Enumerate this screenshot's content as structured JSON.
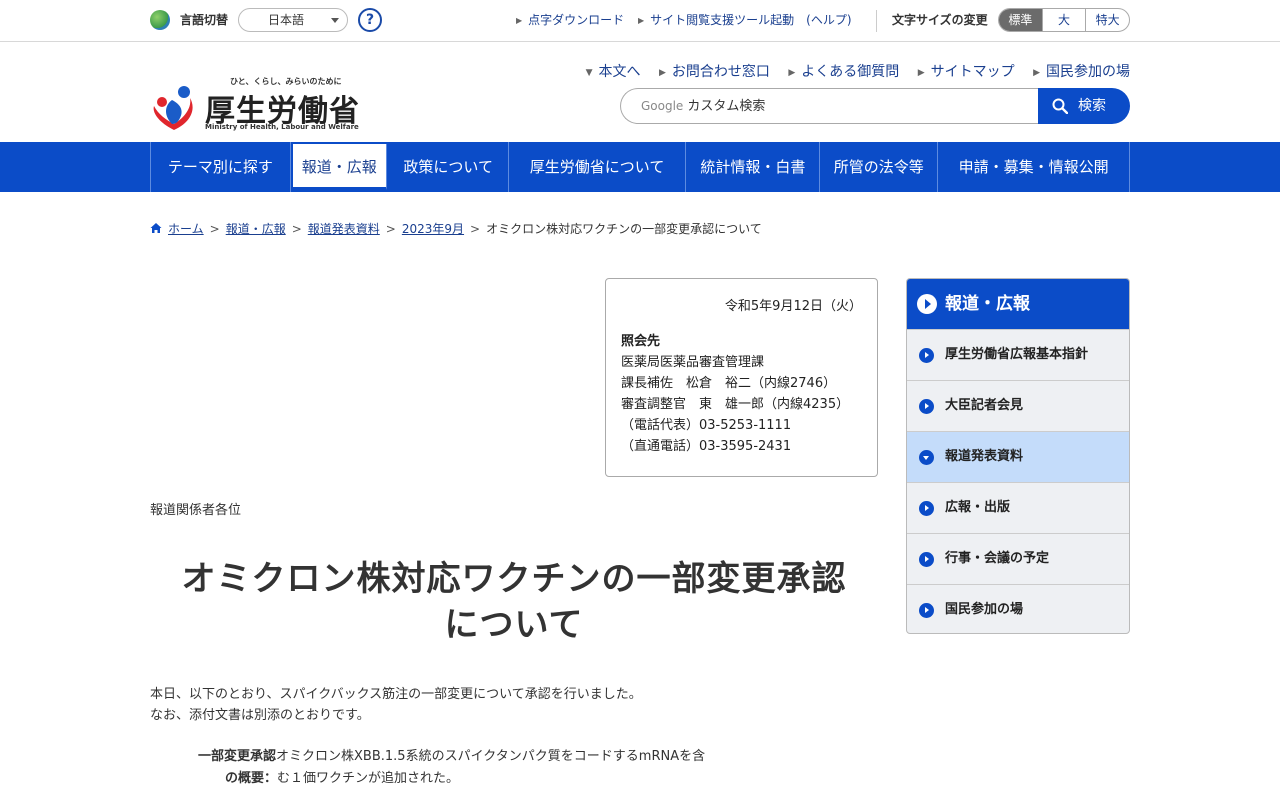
{
  "util": {
    "lang_label": "言語切替",
    "lang_value": "日本語",
    "help": "?",
    "links": [
      "点字ダウンロード",
      "サイト閲覧支援ツール起動　(ヘルプ)"
    ],
    "fontsize_label": "文字サイズの変更",
    "fontsize_options": [
      "標準",
      "大",
      "特大"
    ]
  },
  "logo": {
    "tagline": "ひと、くらし、みらいのために",
    "title": "厚生労働省",
    "english": "Ministry of Health, Labour and Welfare"
  },
  "header_links": [
    "本文へ",
    "お問合わせ窓口",
    "よくある御質問",
    "サイトマップ",
    "国民参加の場"
  ],
  "search": {
    "brand": "Google",
    "placeholder": "カスタム検索",
    "button": "検索"
  },
  "gnav": [
    "テーマ別に探す",
    "報道・広報",
    "政策について",
    "厚生労働省について",
    "統計情報・白書",
    "所管の法令等",
    "申請・募集・情報公開"
  ],
  "breadcrumb": [
    "ホーム",
    "報道・広報",
    "報道発表資料",
    "2023年9月",
    "オミクロン株対応ワクチンの一部変更承認について"
  ],
  "contact": {
    "date": "令和5年9月12日（火）",
    "heading": "照会先",
    "lines": [
      "医薬局医薬品審査管理課",
      "課長補佐　松倉　裕二（内線2746）",
      "審査調整官　東　雄一郎（内線4235）",
      "（電話代表）03-5253-1111",
      "（直通電話）03-3595-2431"
    ]
  },
  "addressee": "報道関係者各位",
  "title_line1": "オミクロン株対応ワクチンの一部変更承認",
  "title_line2": "について",
  "body": {
    "p1": "本日、以下のとおり、スパイクバックス筋注の一部変更について承認を行いました。",
    "p2": "なお、添付文書は別添のとおりです。"
  },
  "detail": {
    "label1": "一部変更承認",
    "text1": "オミクロン株XBB.1.5系統のスパイクタンパク質をコードするmRNAを含",
    "label2": "の概要：",
    "text2": "む１価ワクチンが追加された。"
  },
  "sidebar": {
    "heading": "報道・広報",
    "items": [
      "厚生労働省広報基本指針",
      "大臣記者会見",
      "報道発表資料",
      "広報・出版",
      "行事・会議の予定",
      "国民参加の場"
    ]
  }
}
